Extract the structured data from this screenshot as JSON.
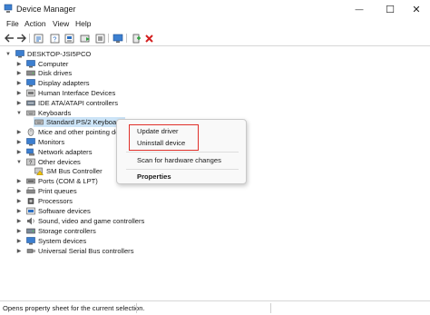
{
  "window": {
    "title": "Device Manager",
    "minimize_glyph": "—",
    "maximize_glyph": "☐",
    "close_glyph": "✕"
  },
  "menu": {
    "items": [
      "File",
      "Action",
      "View",
      "Help"
    ]
  },
  "toolbar": {
    "icons": [
      "back-icon",
      "forward-icon",
      "properties-icon",
      "help-icon",
      "update-driver-icon",
      "disable-icon",
      "scan-hardware-icon",
      "add-driver-icon",
      "uninstall-icon"
    ]
  },
  "tree": {
    "root": "DESKTOP-JSI5PCO",
    "nodes": [
      {
        "label": "Computer",
        "expanded": false
      },
      {
        "label": "Disk drives",
        "expanded": false
      },
      {
        "label": "Display adapters",
        "expanded": false
      },
      {
        "label": "Human Interface Devices",
        "expanded": false
      },
      {
        "label": "IDE ATA/ATAPI controllers",
        "expanded": false
      },
      {
        "label": "Keyboards",
        "expanded": true
      },
      {
        "label": "Standard PS/2 Keyboard",
        "child": true,
        "selected": true
      },
      {
        "label": "Mice and other pointing de",
        "expanded": false
      },
      {
        "label": "Monitors",
        "expanded": false
      },
      {
        "label": "Network adapters",
        "expanded": false
      },
      {
        "label": "Other devices",
        "expanded": true
      },
      {
        "label": "SM Bus Controller",
        "child": true,
        "warning": true
      },
      {
        "label": "Ports (COM & LPT)",
        "expanded": false
      },
      {
        "label": "Print queues",
        "expanded": false
      },
      {
        "label": "Processors",
        "expanded": false
      },
      {
        "label": "Software devices",
        "expanded": false
      },
      {
        "label": "Sound, video and game controllers",
        "expanded": false
      },
      {
        "label": "Storage controllers",
        "expanded": false
      },
      {
        "label": "System devices",
        "expanded": false
      },
      {
        "label": "Universal Serial Bus controllers",
        "expanded": false
      }
    ]
  },
  "context_menu": {
    "update_driver": "Update driver",
    "uninstall_device": "Uninstall device",
    "scan": "Scan for hardware changes",
    "properties": "Properties"
  },
  "status": {
    "text": "Opens property sheet for the current selection."
  },
  "colors": {
    "selection": "#cce4f7",
    "highlight_border": "#e0302a",
    "delete_red": "#d42020",
    "icon_blue": "#2b6fc2"
  }
}
